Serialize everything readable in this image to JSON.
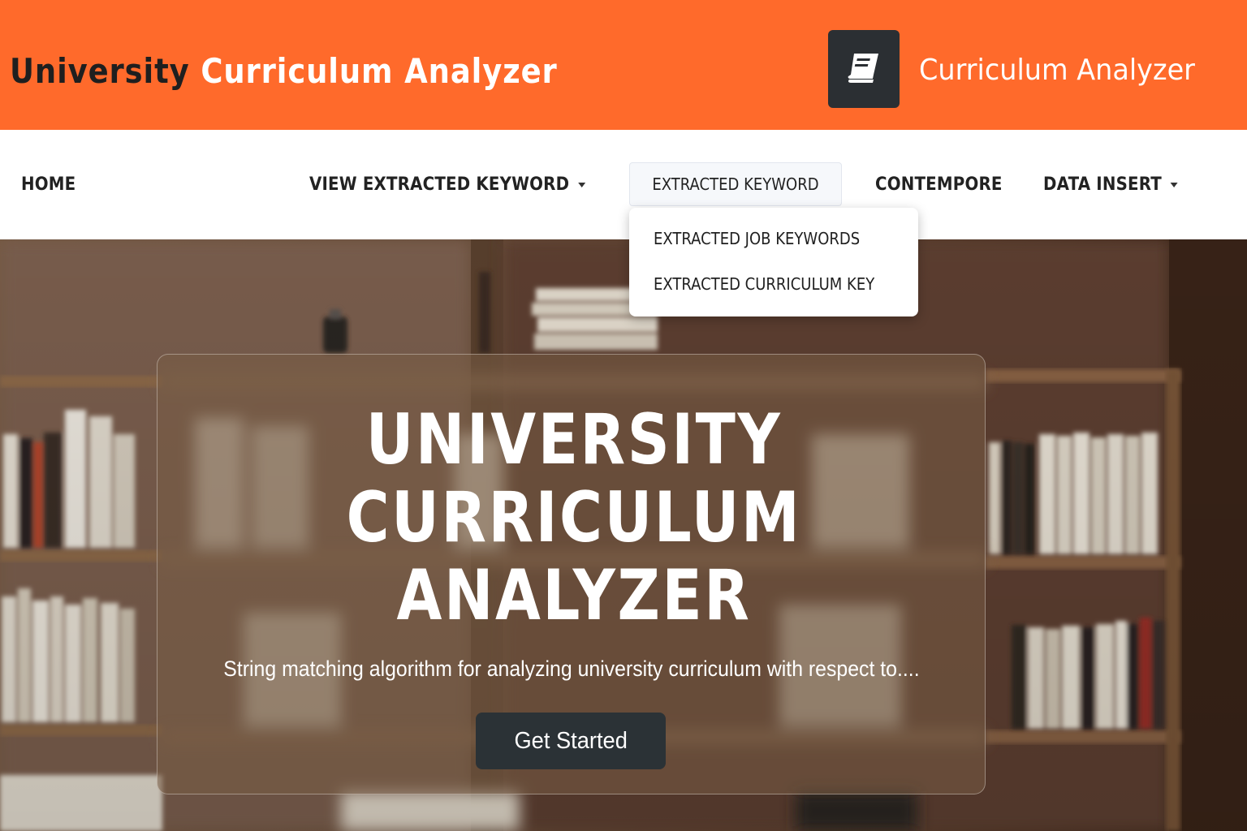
{
  "header": {
    "title_part1": "University",
    "title_part2": "Curriculum Analyzer",
    "brand_icon": "book-icon",
    "brand_name": "Curriculum Analyzer"
  },
  "nav": {
    "home": "HOME",
    "view_extracted_keyword": "VIEW EXTRACTED KEYWORD",
    "extracted_keyword": "EXTRACTED KEYWORD",
    "contempore": "CONTEMPORE",
    "data_insert": "DATA INSERT"
  },
  "dropdown": {
    "items": [
      {
        "label": "EXTRACTED JOB KEYWORDS"
      },
      {
        "label": "EXTRACTED CURRICULUM KEY"
      }
    ]
  },
  "hero": {
    "title_lines": [
      "UNIVERSITY",
      "CURRICULUM",
      "ANALYZER"
    ],
    "subtitle": "String matching algorithm for analyzing university curriculum with respect to....",
    "cta_label": "Get Started"
  },
  "colors": {
    "header_bg": "#ff6a2b",
    "brand_logo_bg": "#2b2f33",
    "navbar_bg": "#ffffff",
    "cta_bg": "#2b3236",
    "text_dark": "#1f1f1f",
    "text_light": "#ffffff"
  }
}
